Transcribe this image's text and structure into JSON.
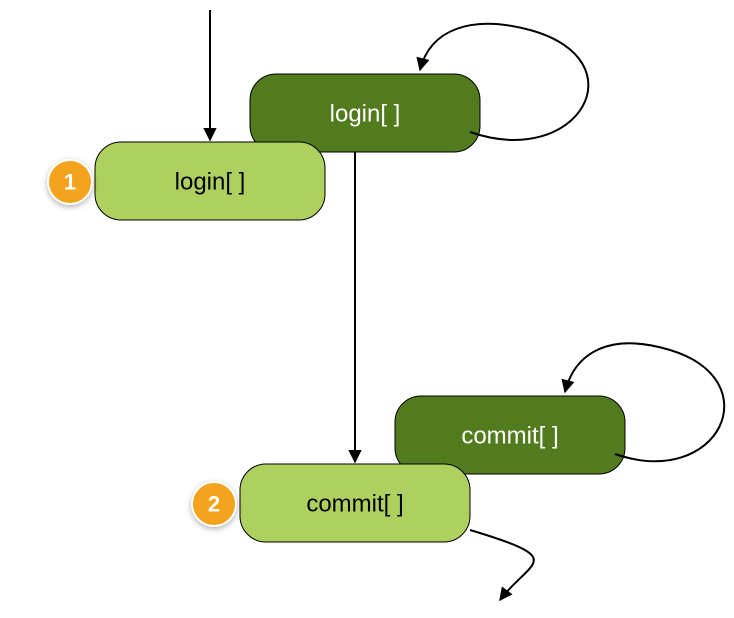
{
  "diagram": {
    "type": "flow",
    "nodes": [
      {
        "id": "login-dark",
        "label": "login[ ]",
        "style": "dark"
      },
      {
        "id": "login-light",
        "label": "login[ ]",
        "style": "light"
      },
      {
        "id": "commit-dark",
        "label": "commit[ ]",
        "style": "dark"
      },
      {
        "id": "commit-light",
        "label": "commit[ ]",
        "style": "light"
      }
    ],
    "badges": [
      {
        "id": "badge-1",
        "label": "1",
        "attachedTo": "login-light"
      },
      {
        "id": "badge-2",
        "label": "2",
        "attachedTo": "commit-light"
      }
    ],
    "edges": [
      {
        "from": "start",
        "to": "login-light"
      },
      {
        "from": "login-dark",
        "to": "login-dark",
        "kind": "self-loop"
      },
      {
        "from": "login-light",
        "to": "commit-light"
      },
      {
        "from": "commit-dark",
        "to": "commit-dark",
        "kind": "self-loop"
      },
      {
        "from": "commit-light",
        "to": "end"
      }
    ]
  },
  "colors": {
    "lightNode": "#aed05e",
    "darkNode": "#527b1d",
    "badge": "#f4a31c",
    "edge": "#000000"
  }
}
